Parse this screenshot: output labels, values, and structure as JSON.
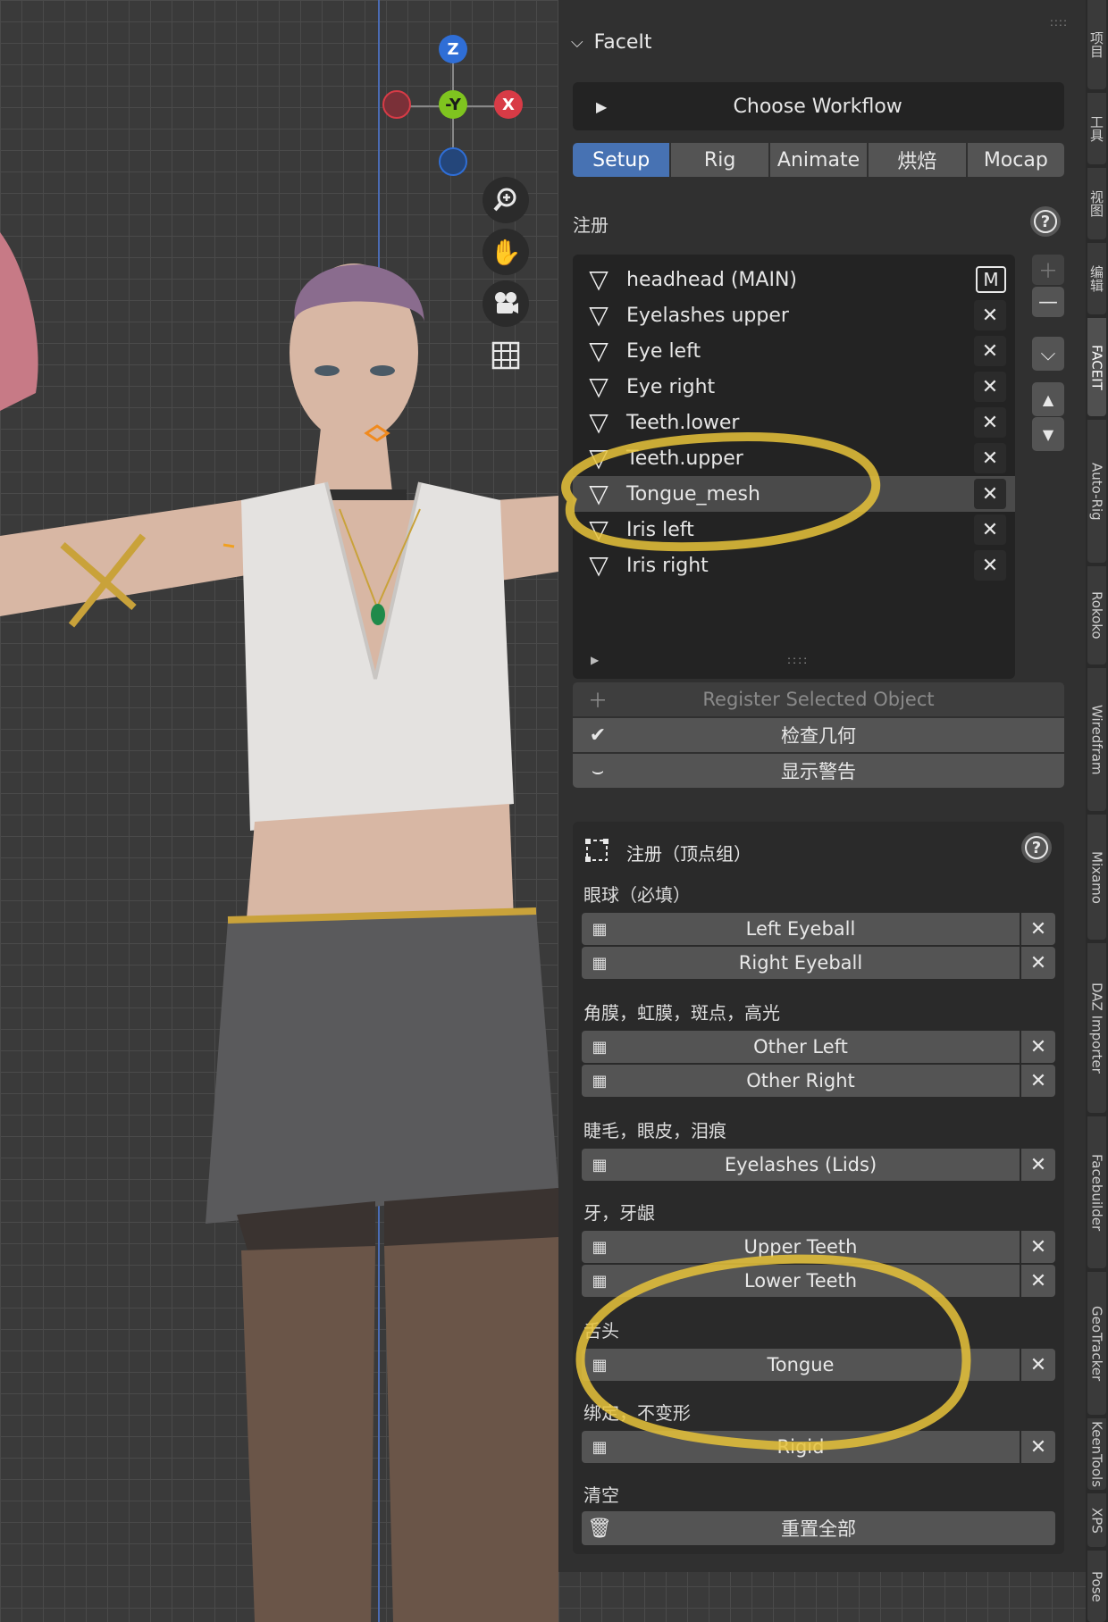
{
  "viewport": {
    "gizmo": {
      "z": "Z",
      "y": "-Y",
      "x": "X"
    },
    "tools": [
      "zoom-icon",
      "hand-icon",
      "camera-icon",
      "grid-icon"
    ]
  },
  "panel": {
    "title": "FaceIt",
    "workflow_label": "Choose Workflow",
    "tabs": [
      "Setup",
      "Rig",
      "Animate",
      "烘焙",
      "Mocap"
    ],
    "active_tab": "Setup",
    "register_label": "注册",
    "objects": [
      {
        "label": "headhead (MAIN)",
        "btn": "M"
      },
      {
        "label": "Eyelashes upper",
        "btn": "✕"
      },
      {
        "label": "Eye left",
        "btn": "✕"
      },
      {
        "label": "Eye right",
        "btn": "✕"
      },
      {
        "label": "Teeth.lower",
        "btn": "✕"
      },
      {
        "label": "Teeth.upper",
        "btn": "✕"
      },
      {
        "label": "Tongue_mesh",
        "btn": "✕"
      },
      {
        "label": "Iris left",
        "btn": "✕"
      },
      {
        "label": "Iris right",
        "btn": "✕"
      }
    ],
    "selected_index": 6,
    "register_selected": "Register Selected Object",
    "check_geometry": "检查几何",
    "show_warnings": "显示警告"
  },
  "vertex_groups": {
    "header": "注册（顶点组）",
    "eyeball_label": "眼球（必填）",
    "left_eyeball": "Left Eyeball",
    "right_eyeball": "Right Eyeball",
    "cornea_label": "角膜，虹膜，斑点，高光",
    "other_left": "Other Left",
    "other_right": "Other Right",
    "lashes_label": "睫毛，眼皮，泪痕",
    "eyelashes": "Eyelashes (Lids)",
    "teeth_label": "牙，牙龈",
    "upper_teeth": "Upper Teeth",
    "lower_teeth": "Lower Teeth",
    "tongue_label": "舌头",
    "tongue": "Tongue",
    "rigid_label": "绑定，不变形",
    "rigid": "Rigid",
    "clear_label": "清空",
    "reset_all": "重置全部"
  },
  "tabstrip": [
    "项目",
    "工具",
    "视图",
    "编辑",
    "FACEIT",
    "Auto-Rig",
    "Rokoko",
    "Wiredfram",
    "Mixamo",
    "DAZ Importer",
    "Facebuilder",
    "GeoTracker",
    "KeenTools",
    "XPS",
    "Pose"
  ],
  "colors": {
    "accent": "#4772b3",
    "annotation": "#e8c33a",
    "axis_x": "#d83b46",
    "axis_y": "#7fc41f",
    "axis_z": "#2f6ed6"
  }
}
